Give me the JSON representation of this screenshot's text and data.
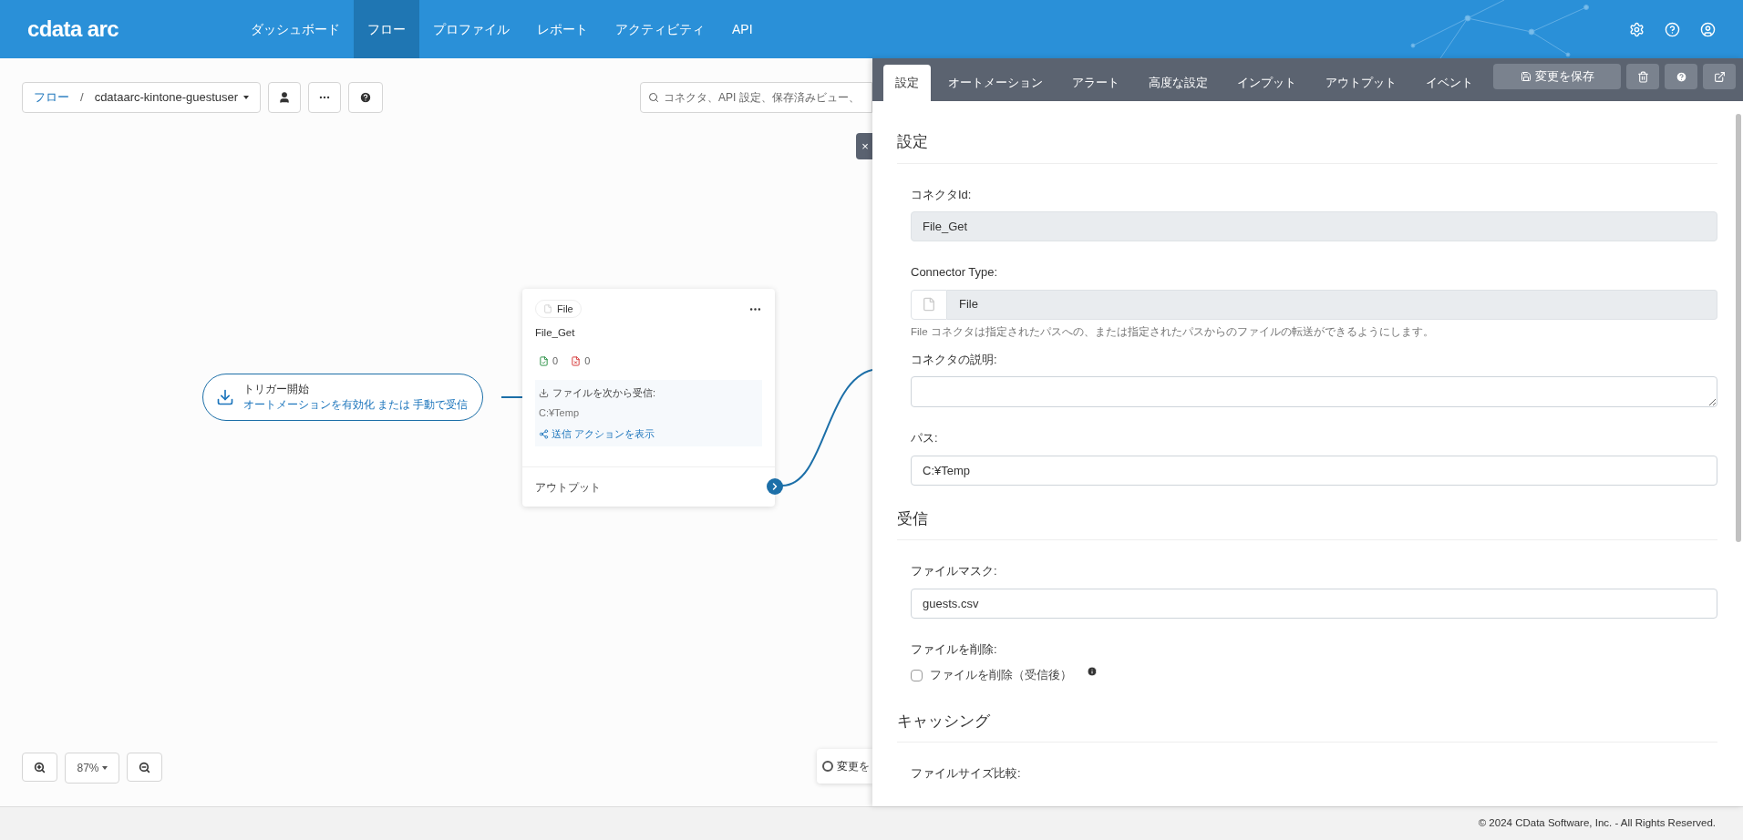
{
  "header": {
    "logo": "cdata arc",
    "nav": [
      {
        "label": "ダッシュボード",
        "selected": false
      },
      {
        "label": "フロー",
        "selected": true
      },
      {
        "label": "プロファイル",
        "selected": false
      },
      {
        "label": "レポート",
        "selected": false
      },
      {
        "label": "アクティビティ",
        "selected": false
      },
      {
        "label": "API",
        "selected": false
      }
    ]
  },
  "breadcrumb": {
    "root": "フロー",
    "separator": "/",
    "current": "cdataarc-kintone-guestuser"
  },
  "search": {
    "placeholder": "コネクタ、API 設定、保存済みビュー、"
  },
  "canvas": {
    "trigger": {
      "title": "トリガー開始",
      "subtitle": "オートメーションを有効化 または 手動で受信"
    },
    "node": {
      "type": "File",
      "name": "File_Get",
      "success_count": "0",
      "error_count": "0",
      "receive_label": "ファイルを次から受信:",
      "path": "C:¥Temp",
      "send_link": "送信 アクションを表示",
      "output": "アウトプット"
    },
    "close": "×",
    "zoom": "87%",
    "toast": "変更を"
  },
  "panel": {
    "tabs": [
      {
        "label": "設定",
        "selected": true
      },
      {
        "label": "オートメーション",
        "selected": false
      },
      {
        "label": "アラート",
        "selected": false
      },
      {
        "label": "高度な設定",
        "selected": false
      },
      {
        "label": "インプット",
        "selected": false
      },
      {
        "label": "アウトプット",
        "selected": false
      },
      {
        "label": "イベント",
        "selected": false
      }
    ],
    "save_button": "変更を保存",
    "sections": [
      {
        "title": "設定",
        "fields": [
          {
            "kind": "readonly",
            "label": "コネクタId:",
            "value": "File_Get"
          },
          {
            "kind": "readonly_icon",
            "label": "Connector Type:",
            "value": "File",
            "help": "File コネクタは指定されたパスへの、または指定されたパスからのファイルの転送ができるようにします。"
          },
          {
            "kind": "textarea",
            "label": "コネクタの説明:"
          },
          {
            "kind": "text",
            "label": "パス:",
            "value": "C:¥Temp"
          }
        ]
      },
      {
        "title": "受信",
        "fields": [
          {
            "kind": "text",
            "label": "ファイルマスク:",
            "value": "guests.csv"
          },
          {
            "kind": "checkbox",
            "label": "ファイルを削除:",
            "option": "ファイルを削除（受信後）",
            "checked": false
          }
        ]
      },
      {
        "title": "キャッシング",
        "fields": [
          {
            "kind": "label",
            "label": "ファイルサイズ比較:"
          }
        ]
      }
    ]
  },
  "footer": {
    "copyright": "© 2024 CData Software, Inc. - All Rights Reserved."
  }
}
